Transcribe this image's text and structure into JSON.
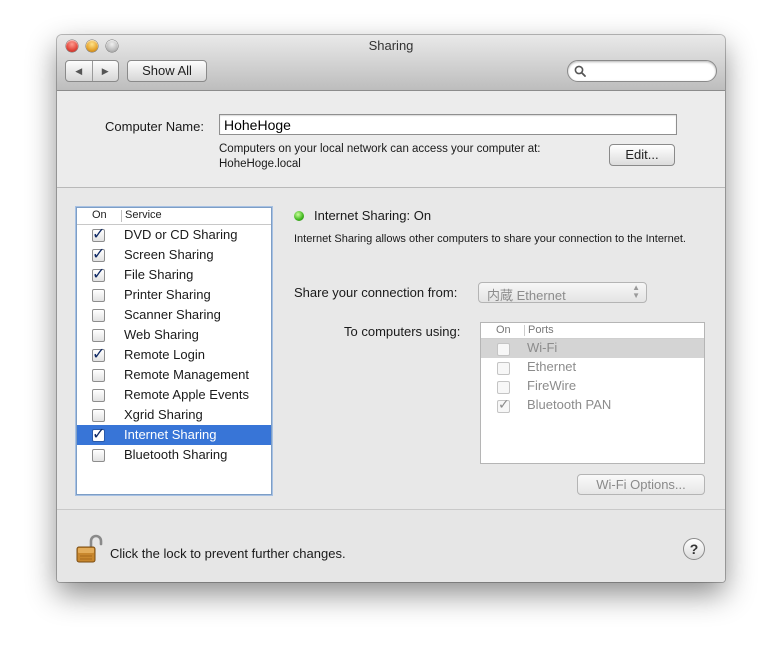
{
  "window": {
    "title": "Sharing"
  },
  "toolbar": {
    "back": "◀",
    "forward": "▶",
    "show_all": "Show All",
    "search_value": ""
  },
  "computer": {
    "label": "Computer Name:",
    "value": "HoheHoge",
    "note_line1": "Computers on your local network can access your computer at:",
    "note_line2": "HoheHoge.local",
    "edit_label": "Edit..."
  },
  "services": {
    "header_on": "On",
    "header_service": "Service",
    "items": [
      {
        "label": "DVD or CD Sharing",
        "checked": true
      },
      {
        "label": "Screen Sharing",
        "checked": true
      },
      {
        "label": "File Sharing",
        "checked": true
      },
      {
        "label": "Printer Sharing",
        "checked": false
      },
      {
        "label": "Scanner Sharing",
        "checked": false
      },
      {
        "label": "Web Sharing",
        "checked": false
      },
      {
        "label": "Remote Login",
        "checked": true
      },
      {
        "label": "Remote Management",
        "checked": false
      },
      {
        "label": "Remote Apple Events",
        "checked": false
      },
      {
        "label": "Xgrid Sharing",
        "checked": false
      },
      {
        "label": "Internet Sharing",
        "checked": true,
        "selected": true
      },
      {
        "label": "Bluetooth Sharing",
        "checked": false
      }
    ]
  },
  "detail": {
    "status": "Internet Sharing: On",
    "status_color": "#3db51c",
    "description": "Internet Sharing allows other computers to share your connection to the Internet.",
    "share_from_label": "Share your connection from:",
    "share_from_value": "内蔵 Ethernet",
    "to_computers_label": "To computers using:",
    "ports_header_on": "On",
    "ports_header_ports": "Ports",
    "ports": [
      {
        "label": "Wi-Fi",
        "checked": false,
        "selected": true
      },
      {
        "label": "Ethernet",
        "checked": false
      },
      {
        "label": "FireWire",
        "checked": false
      },
      {
        "label": "Bluetooth PAN",
        "checked": true
      }
    ],
    "wifi_options_label": "Wi-Fi Options..."
  },
  "footer": {
    "lock_text": "Click the lock to prevent further changes.",
    "help": "?"
  },
  "colors": {
    "selection": "#3875d7",
    "accent_border": "#7d9ec6"
  }
}
